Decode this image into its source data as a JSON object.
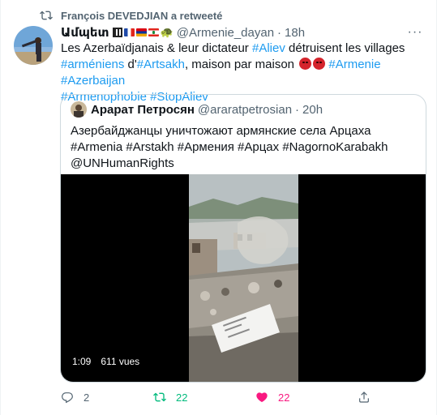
{
  "retweet_bar": {
    "text": "François DEVEDJIAN a retweeté"
  },
  "tweet": {
    "author_name": "Ամպետ",
    "handle": "@Armenie_dayan",
    "separator": "·",
    "time": "18h",
    "text_parts": {
      "p1": "Les Azerbaïdjanais & leur dictateur ",
      "t1": "#Aliev",
      "p2": " détruisent les villages ",
      "t2": "#arméniens",
      "p3": " d'",
      "t3": "#Artsakh",
      "p4": ", maison par maison ",
      "t4": "#Armenie",
      "t5": "#Azerbaijan",
      "t6": "#Armenophobie",
      "t7": "#StopAliev"
    }
  },
  "quote": {
    "author_name": "Арарат Петросян",
    "handle": "@araratpetrosian",
    "separator": "·",
    "time": "20h",
    "text": "Азербайджанцы уничтожают армянские села Арцаха #Armenia #Arstakh #Армения #Арцах #NagornoKarabakh @UNHumanRights",
    "video": {
      "duration": "1:09",
      "views": "611 vues"
    }
  },
  "actions": {
    "reply_count": "2",
    "retweet_count": "22",
    "like_count": "22"
  },
  "colors": {
    "accent": "#1d9bf0",
    "retweet_active": "#00ba7c",
    "like_active": "#f91880",
    "muted": "#536471"
  },
  "icons": [
    "retweet-icon",
    "more-icon",
    "reply-icon",
    "like-icon",
    "share-icon"
  ]
}
